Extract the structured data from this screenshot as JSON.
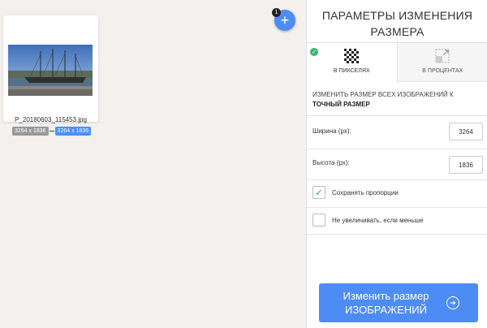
{
  "workspace": {
    "file": {
      "name": "P_20180603_115453.jpg",
      "original_size": "3264 x 1836",
      "new_size": "3264 x 1836"
    },
    "add_button": {
      "icon": "plus-icon",
      "badge_count": "1"
    }
  },
  "panel": {
    "title_line1": "ПАРАМЕТРЫ ИЗМЕНЕНИЯ",
    "title_line2": "РАЗМЕРА",
    "tabs": [
      {
        "label": "В ПИКСЕЛЯХ",
        "icon": "pixels-icon",
        "active": true
      },
      {
        "label": "В ПРОЦЕНТАХ",
        "icon": "percent-resize-icon",
        "active": false
      }
    ],
    "description_line1": "ИЗМЕНИТЬ РАЗМЕР ВСЕХ ИЗОБРАЖЕНИЙ К",
    "description_line2": "ТОЧНЫЙ РАЗМЕР",
    "width": {
      "label": "Ширина (px):",
      "value": "3264"
    },
    "height": {
      "label": "Высота (px):",
      "value": "1836"
    },
    "keep_ratio": {
      "label": "Сохранять пропорции",
      "checked": true
    },
    "no_enlarge": {
      "label": "Не увеличивать, если меньше",
      "checked": false
    },
    "submit_line1": "Изменить размер",
    "submit_line2": "ИЗОБРАЖЕНИЙ",
    "accent_color": "#4e8cf5",
    "check_color": "#3cb371"
  }
}
